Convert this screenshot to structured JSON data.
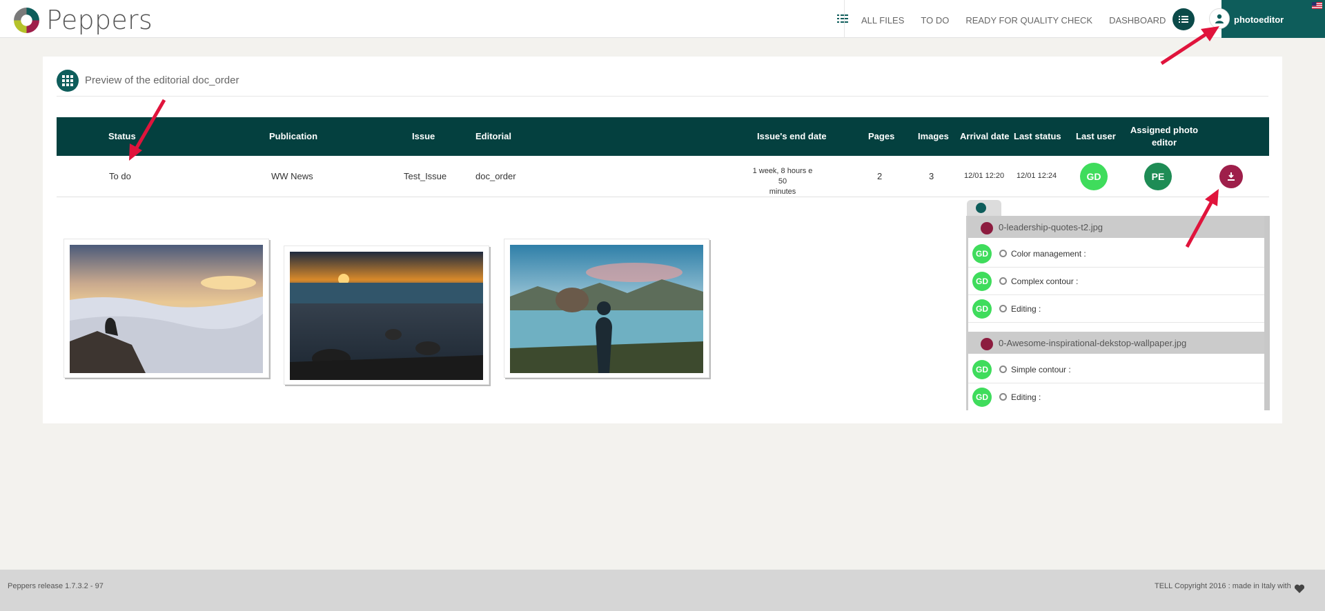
{
  "app": {
    "name": "Peppers"
  },
  "nav": {
    "items": [
      "ALL FILES",
      "TO DO",
      "READY FOR QUALITY CHECK",
      "DASHBOARD"
    ]
  },
  "user": {
    "name": "photoeditor"
  },
  "page": {
    "title": "Preview of the editorial doc_order"
  },
  "table": {
    "headers": {
      "status": "Status",
      "publication": "Publication",
      "issue": "Issue",
      "editorial": "Editorial",
      "end_date": "Issue's end date",
      "pages": "Pages",
      "images": "Images",
      "arrival": "Arrival date",
      "last_status": "Last status",
      "last_user": "Last user",
      "assigned_line1": "Assigned photo",
      "assigned_line2": "editor"
    },
    "row": {
      "status": "To do",
      "publication": "WW News",
      "issue": "Test_Issue",
      "editorial": "doc_order",
      "end_date_line1": "1 week, 8 hours e 50",
      "end_date_line2": "minutes",
      "pages": "2",
      "images": "3",
      "arrival": "12/01 12:20",
      "last_status": "12/01 12:24",
      "last_user": "GD",
      "assigned": "PE"
    }
  },
  "files": [
    {
      "name": "0-leadership-quotes-t2.jpg",
      "tasks": [
        {
          "user": "GD",
          "label": "Color management :"
        },
        {
          "user": "GD",
          "label": "Complex contour :"
        },
        {
          "user": "GD",
          "label": "Editing :"
        }
      ]
    },
    {
      "name": "0-Awesome-inspirational-dekstop-wallpaper.jpg",
      "tasks": [
        {
          "user": "GD",
          "label": "Simple contour :"
        },
        {
          "user": "GD",
          "label": "Editing :"
        }
      ]
    }
  ],
  "footer": {
    "release": "Peppers release 1.7.3.2 - 97",
    "copyright": "TELL Copyright 2016 : made in Italy with"
  },
  "colors": {
    "primary": "#0e5d5b",
    "table_header": "#04403f",
    "user_green": "#3fdc5c",
    "editor_green": "#1e8c55",
    "download": "#9e1f4a",
    "arrow": "#e0143c"
  }
}
